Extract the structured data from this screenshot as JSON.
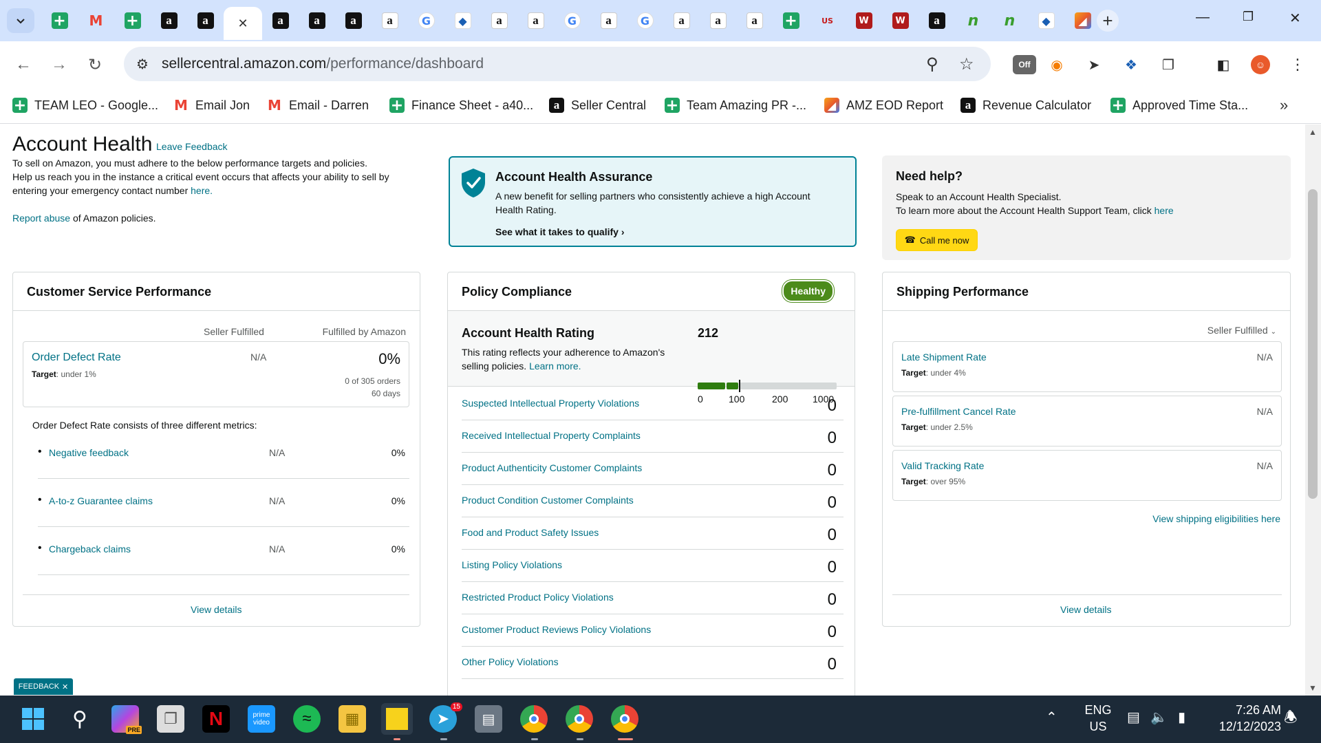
{
  "browser": {
    "tabs": [
      {
        "icon": "sheets-icon"
      },
      {
        "icon": "gmail-icon"
      },
      {
        "icon": "sheets-icon"
      },
      {
        "icon": "amazon-icon"
      },
      {
        "icon": "amazon-icon"
      },
      {
        "icon": "close-icon",
        "active": true
      },
      {
        "icon": "amazon-icon"
      },
      {
        "icon": "amazon-icon"
      },
      {
        "icon": "amazon-icon"
      },
      {
        "icon": "amazon-light-icon"
      },
      {
        "icon": "google-icon"
      },
      {
        "icon": "diamond-icon"
      },
      {
        "icon": "amazon-light-icon"
      },
      {
        "icon": "amazon-light-icon"
      },
      {
        "icon": "google-icon"
      },
      {
        "icon": "amazon-light-icon"
      },
      {
        "icon": "google-icon"
      },
      {
        "icon": "amazon-light-icon"
      },
      {
        "icon": "amazon-light-icon"
      },
      {
        "icon": "amazon-light-icon"
      },
      {
        "icon": "sheets-icon"
      },
      {
        "icon": "usfoods-icon"
      },
      {
        "icon": "w-icon"
      },
      {
        "icon": "w-icon"
      },
      {
        "icon": "amazon-icon"
      },
      {
        "icon": "nn-icon"
      },
      {
        "icon": "nn-icon"
      },
      {
        "icon": "diamond-icon"
      },
      {
        "icon": "multi-icon"
      }
    ],
    "url_host": "sellercentral.amazon.com",
    "url_path": "/performance/dashboard",
    "bookmarks": [
      {
        "label": "TEAM LEO - Google...",
        "icon": "sheets-icon"
      },
      {
        "label": "Email Jon",
        "icon": "gmail-icon"
      },
      {
        "label": "Email - Darren",
        "icon": "gmail-icon"
      },
      {
        "label": "Finance Sheet - a40...",
        "icon": "sheets-icon"
      },
      {
        "label": "Seller Central",
        "icon": "amazon-icon"
      },
      {
        "label": "Team Amazing PR -...",
        "icon": "sheets-icon"
      },
      {
        "label": "AMZ EOD Report",
        "icon": "multi-icon"
      },
      {
        "label": "Revenue Calculator",
        "icon": "amazon-icon"
      },
      {
        "label": "Approved Time Sta...",
        "icon": "sheets-icon"
      }
    ],
    "ext_off_badge": "Off"
  },
  "header": {
    "title": "Account Health",
    "leave_feedback": "Leave Feedback",
    "intro_line1": "To sell on Amazon, you must adhere to the below performance targets and policies.",
    "intro_line2": "Help us reach you in the instance a critical event occurs that affects your ability to sell by entering your emergency contact number ",
    "intro_link": "here.",
    "report_link": "Report abuse",
    "report_rest": " of Amazon policies."
  },
  "assurance": {
    "title": "Account Health Assurance",
    "text": "A new benefit for selling partners who consistently achieve a high Account Health Rating.",
    "link": "See what it takes to qualify"
  },
  "help": {
    "title": "Need help?",
    "line1": "Speak to an Account Health Specialist.",
    "line2": "To learn more about the Account Health Support Team, click ",
    "line2_link": "here",
    "button": "Call me now"
  },
  "customer_service": {
    "title": "Customer Service Performance",
    "col_seller": "Seller Fulfilled",
    "col_fba": "Fulfilled by Amazon",
    "odr_label": "Order Defect Rate",
    "odr_target_label": "Target",
    "odr_target": ": under 1%",
    "odr_seller": "N/A",
    "odr_fba": "0%",
    "odr_orders": "0 of 305 orders",
    "odr_days": "60 days",
    "consists": "Order Defect Rate consists of three different metrics:",
    "metrics": [
      {
        "label": "Negative feedback",
        "seller": "N/A",
        "fba": "0%"
      },
      {
        "label": "A-to-z Guarantee claims",
        "seller": "N/A",
        "fba": "0%"
      },
      {
        "label": "Chargeback claims",
        "seller": "N/A",
        "fba": "0%"
      }
    ],
    "view_details": "View details"
  },
  "policy": {
    "title": "Policy Compliance",
    "badge": "Healthy",
    "ahr_title": "Account Health Rating",
    "ahr_text": "This rating reflects your adherence to Amazon's selling policies. ",
    "ahr_link": "Learn more.",
    "ahr_value": "212",
    "ahr_fraction": 0.212,
    "ticks": [
      "0",
      "100",
      "200",
      "1000"
    ],
    "rows": [
      {
        "label": "Suspected Intellectual Property Violations",
        "value": "0"
      },
      {
        "label": "Received Intellectual Property Complaints",
        "value": "0"
      },
      {
        "label": "Product Authenticity Customer Complaints",
        "value": "0"
      },
      {
        "label": "Product Condition Customer Complaints",
        "value": "0"
      },
      {
        "label": "Food and Product Safety Issues",
        "value": "0"
      },
      {
        "label": "Listing Policy Violations",
        "value": "0"
      },
      {
        "label": "Restricted Product Policy Violations",
        "value": "0"
      },
      {
        "label": "Customer Product Reviews Policy Violations",
        "value": "0"
      },
      {
        "label": "Other Policy Violations",
        "value": "0"
      }
    ],
    "colors": {
      "good": "#2f7d10",
      "neutral": "#d5d9d9"
    }
  },
  "shipping": {
    "title": "Shipping Performance",
    "filter": "Seller Fulfilled",
    "metrics": [
      {
        "label": "Late Shipment Rate",
        "target_label": "Target",
        "target": ": under 4%",
        "value": "N/A"
      },
      {
        "label": "Pre-fulfillment Cancel Rate",
        "target_label": "Target",
        "target": ": under 2.5%",
        "value": "N/A"
      },
      {
        "label": "Valid Tracking Rate",
        "target_label": "Target",
        "target": ": over 95%",
        "value": "N/A"
      }
    ],
    "eligibility_link": "View shipping eligibilities here",
    "view_details": "View details"
  },
  "feedback_tab": "FEEDBACK",
  "taskbar": {
    "lang": "ENG",
    "region": "US",
    "time": "7:26 AM",
    "date": "12/12/2023",
    "telegram_badge": "15",
    "copilot_badge": "PRE",
    "prime_label_1": "prime",
    "prime_label_2": "video"
  }
}
